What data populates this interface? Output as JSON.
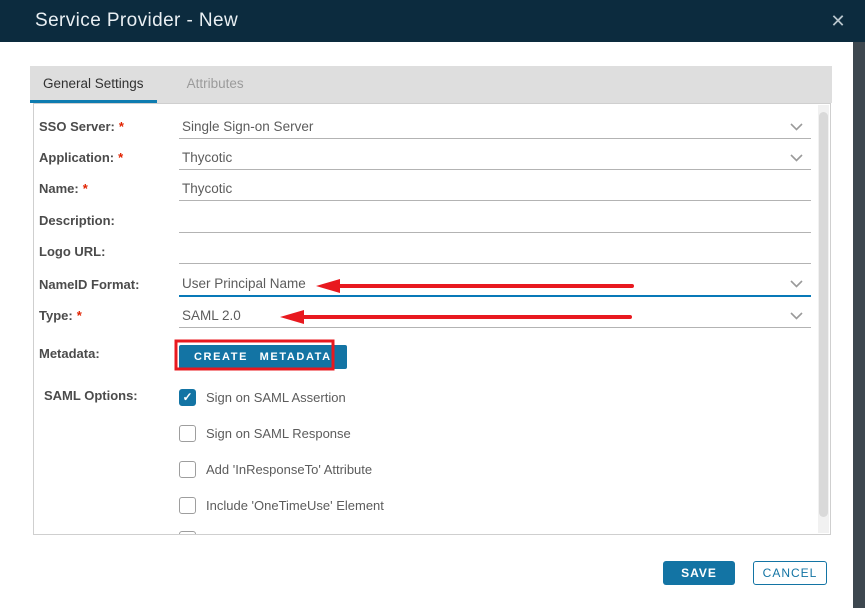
{
  "dialog": {
    "title": "Service Provider - New",
    "close_glyph": "✕"
  },
  "tabs": [
    {
      "label": "General Settings",
      "active": true
    },
    {
      "label": "Attributes",
      "active": false
    }
  ],
  "form": {
    "fields": [
      {
        "label": "SSO Server:",
        "required_mark": "*",
        "value": "Single Sign-on Server",
        "type": "select"
      },
      {
        "label": "Application:",
        "required_mark": "*",
        "value": "Thycotic",
        "type": "select"
      },
      {
        "label": "Name:",
        "required_mark": "*",
        "value": "Thycotic",
        "type": "text"
      },
      {
        "label": "Description:",
        "required_mark": "",
        "value": "",
        "type": "text"
      },
      {
        "label": "Logo URL:",
        "required_mark": "",
        "value": "",
        "type": "text"
      },
      {
        "label": "NameID Format:",
        "required_mark": "",
        "value": "User Principal Name",
        "type": "select",
        "focused": true,
        "annotated": "red-arrow"
      },
      {
        "label": "Type:",
        "required_mark": "*",
        "value": "SAML 2.0",
        "type": "select",
        "annotated": "red-arrow"
      }
    ],
    "metadata": {
      "label": "Metadata:",
      "button_label": "CREATE METADATA",
      "annotated": "red-box"
    },
    "saml_options": {
      "label": "SAML Options:",
      "check_glyph": "✓",
      "options": [
        {
          "label": "Sign on SAML Assertion",
          "checked": true
        },
        {
          "label": "Sign on SAML Response",
          "checked": false
        },
        {
          "label": "Add 'InResponseTo' Attribute",
          "checked": false
        },
        {
          "label": "Include 'OneTimeUse' Element",
          "checked": false
        }
      ]
    }
  },
  "footer": {
    "save_label": "SAVE",
    "cancel_label": "CANCEL"
  },
  "colors": {
    "header_navy": "#0c2b3e",
    "accent_blue": "#1374a4",
    "tab_underline_blue": "#0e7cb0",
    "focus_underline_blue": "#0879b8",
    "annotation_red": "#e8191f",
    "required_red": "#e12200",
    "tabbar_gray": "#dedede",
    "page_behind_strip": "#3d474f"
  }
}
